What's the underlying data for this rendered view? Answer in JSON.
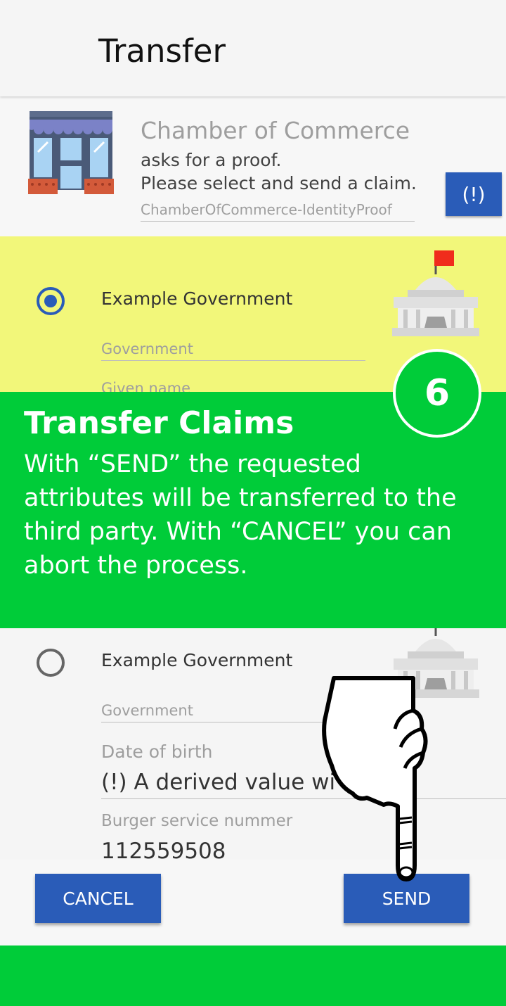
{
  "appbar": {
    "title": "Transfer"
  },
  "request": {
    "requester": "Chamber of Commerce",
    "line1": "asks for a proof.",
    "line2": "Please select and send a claim.",
    "proof_id": "ChamberOfCommerce-IdentityProof",
    "info_button_label": "(!)"
  },
  "claims": [
    {
      "issuer": "Example Government",
      "selected": true,
      "fields": [
        {
          "label": "Government"
        },
        {
          "label": "Given name"
        }
      ]
    },
    {
      "issuer": "Example Government",
      "selected": false,
      "fields": [
        {
          "label": "Government"
        },
        {
          "label": "Date of birth",
          "value": "(!) A derived value wi      nd."
        },
        {
          "label": "Burger service nummer",
          "value": "112559508"
        }
      ]
    }
  ],
  "tutorial": {
    "step_number": "6",
    "title": "Transfer Claims",
    "text": "With “SEND” the requested attributes will be transferred to the third party. With “CANCEL” you can abort the process."
  },
  "actions": {
    "cancel_label": "CANCEL",
    "send_label": "SEND"
  },
  "colors": {
    "accent": "#2a5cb8",
    "tutorial_green": "#00cc39",
    "highlight_yellow": "#f2f77a",
    "background": "#f5f5f5"
  },
  "icons": {
    "requester": "storefront-icon",
    "issuer": "government-building-icon",
    "pointer": "pointing-hand-icon"
  }
}
